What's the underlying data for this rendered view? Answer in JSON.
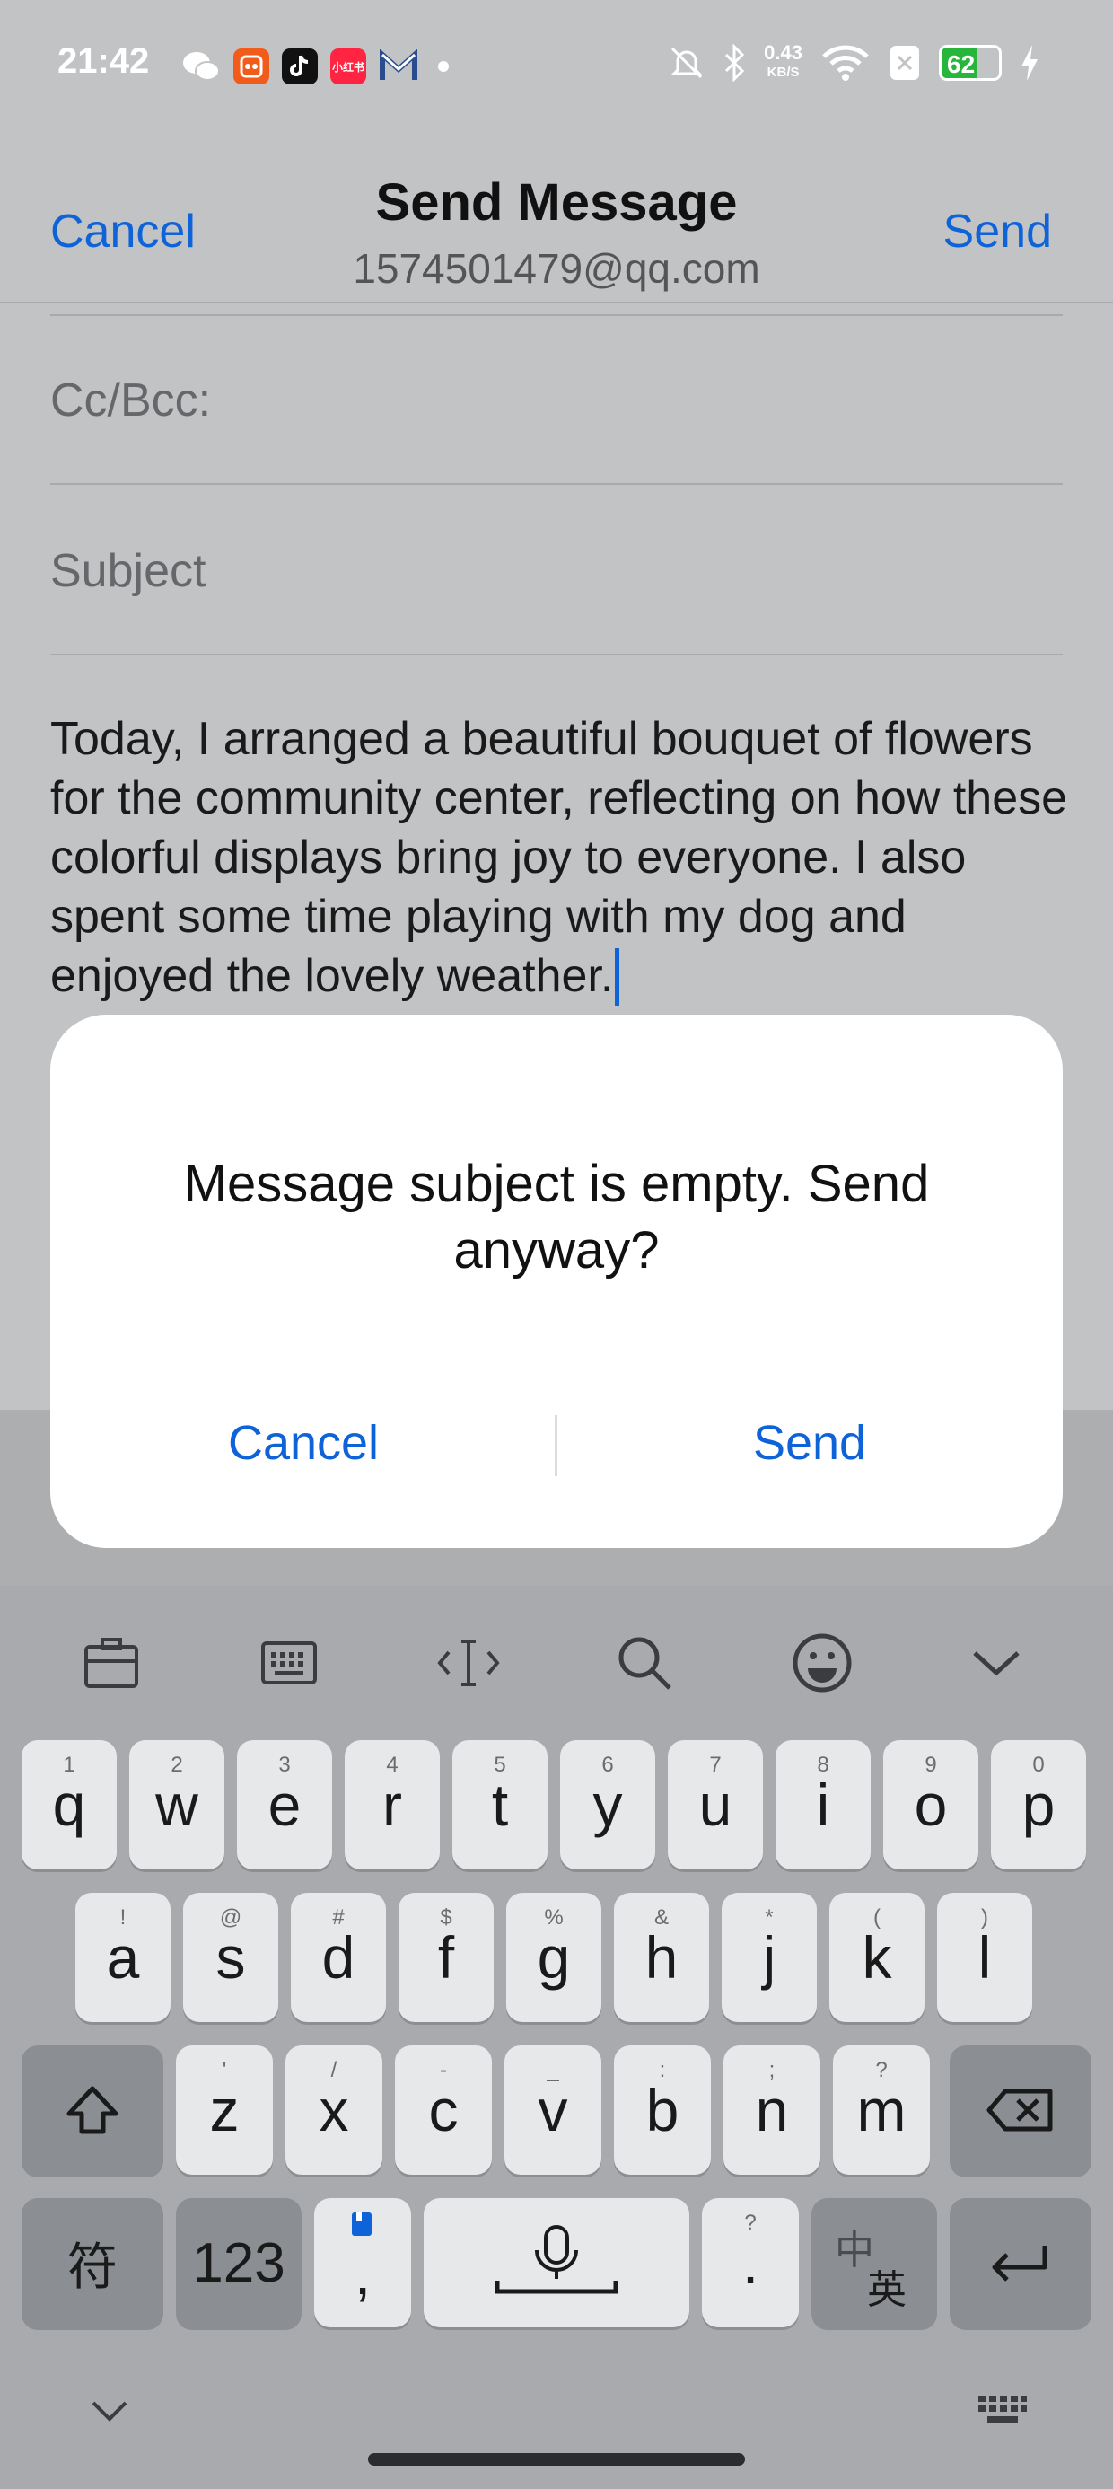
{
  "status_bar": {
    "time": "21:42",
    "net_speed": "0.43",
    "net_unit": "KB/S",
    "battery": "62",
    "apps": [
      "wechat-icon",
      "taobao-icon",
      "tiktok-icon",
      "xiaohongshu-icon",
      "gmail-icon"
    ],
    "app_label_xhs": "小红书"
  },
  "header": {
    "cancel": "Cancel",
    "title": "Send Message",
    "subtitle": "1574501479@qq.com",
    "send": "Send"
  },
  "form": {
    "cc_bcc": "Cc/Bcc:",
    "subject_placeholder": "Subject",
    "body": "Today, I arranged a beautiful bouquet of flowers for the community center, reflecting on how these colorful displays bring joy to everyone. I also spent some time playing with my dog and enjoyed the lovely weather."
  },
  "dialog": {
    "message": "Message subject is empty. Send anyway?",
    "cancel": "Cancel",
    "send": "Send"
  },
  "keyboard": {
    "toolbar": [
      "clipboard-icon",
      "keyboard-layout-icon",
      "cursor-icon",
      "search-icon",
      "emoji-icon",
      "collapse-icon"
    ],
    "row1": [
      [
        "q",
        "1"
      ],
      [
        "w",
        "2"
      ],
      [
        "e",
        "3"
      ],
      [
        "r",
        "4"
      ],
      [
        "t",
        "5"
      ],
      [
        "y",
        "6"
      ],
      [
        "u",
        "7"
      ],
      [
        "i",
        "8"
      ],
      [
        "o",
        "9"
      ],
      [
        "p",
        "0"
      ]
    ],
    "row2": [
      [
        "a",
        "!"
      ],
      [
        "s",
        "@"
      ],
      [
        "d",
        "#"
      ],
      [
        "f",
        "$"
      ],
      [
        "g",
        "%"
      ],
      [
        "h",
        "&"
      ],
      [
        "j",
        "*"
      ],
      [
        "k",
        "("
      ],
      [
        "l",
        ")"
      ]
    ],
    "row3": [
      [
        "z",
        "'"
      ],
      [
        "x",
        "/"
      ],
      [
        "c",
        "-"
      ],
      [
        "v",
        "_"
      ],
      [
        "b",
        ":"
      ],
      [
        "n",
        ";"
      ],
      [
        "m",
        "?"
      ]
    ],
    "symbols": "符",
    "numbers": "123",
    "comma": ",",
    "period": ".",
    "period_hint": "?",
    "lang_top": "中",
    "lang_bottom": "英"
  },
  "colors": {
    "accent": "#0e63d8",
    "battery": "#27b53c"
  }
}
